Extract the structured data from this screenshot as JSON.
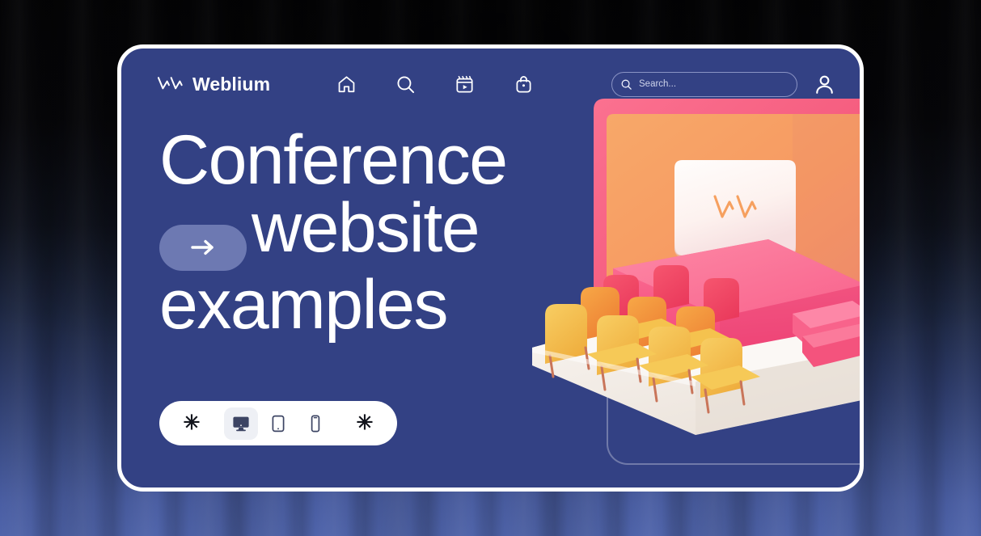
{
  "background": {
    "style": "dark-curtain-with-blue-glow",
    "top_color": "#050507",
    "bottom_color": "#4f64ab"
  },
  "card": {
    "background_color": "#334184",
    "border_color": "#ffffff",
    "accent_pill_color": "#6d79b2"
  },
  "nav": {
    "brand_name": "Weblium",
    "brand_logo_icon": "weblium-w-logo-icon",
    "items": [
      {
        "icon": "home-icon",
        "label": "Home"
      },
      {
        "icon": "search-icon",
        "label": "Search"
      },
      {
        "icon": "video-player-icon",
        "label": "Videos"
      },
      {
        "icon": "shopping-bag-icon",
        "label": "Store"
      }
    ],
    "search": {
      "placeholder": "Search...",
      "value": "",
      "icon": "search-icon"
    },
    "account_icon": "user-avatar-icon"
  },
  "hero": {
    "line1": "Conference",
    "arrow_icon": "arrow-right-icon",
    "line2": "website",
    "line3": "examples"
  },
  "device_switcher": {
    "left_decor": "✳",
    "right_decor": "✳",
    "selected": "desktop",
    "options": [
      {
        "id": "desktop",
        "icon": "desktop-monitor-icon",
        "label": "Desktop",
        "selected": true
      },
      {
        "id": "tablet",
        "icon": "tablet-icon",
        "label": "Tablet",
        "selected": false
      },
      {
        "id": "mobile",
        "icon": "mobile-phone-icon",
        "label": "Mobile",
        "selected": false
      }
    ]
  },
  "illustration": {
    "name": "3d-conference-auditorium",
    "description": "3D conference hall with stage, presentation screen and rows of chairs",
    "screen_logo_icon": "weblium-w-logo-icon",
    "colors": {
      "backdrop": "#f3a368",
      "backdrop_frame": "#f4627f",
      "stage": "#f7567f",
      "screen": "#fdf3f1",
      "screen_logo": "#f6a05f",
      "floor": "#f2ece6",
      "chair_front": "#f3c14f",
      "chair_mid": "#f0943c",
      "chair_back": "#f04f63",
      "chair_leg": "#c9755a"
    },
    "chair_rows": 2,
    "chairs_per_row": 4
  }
}
